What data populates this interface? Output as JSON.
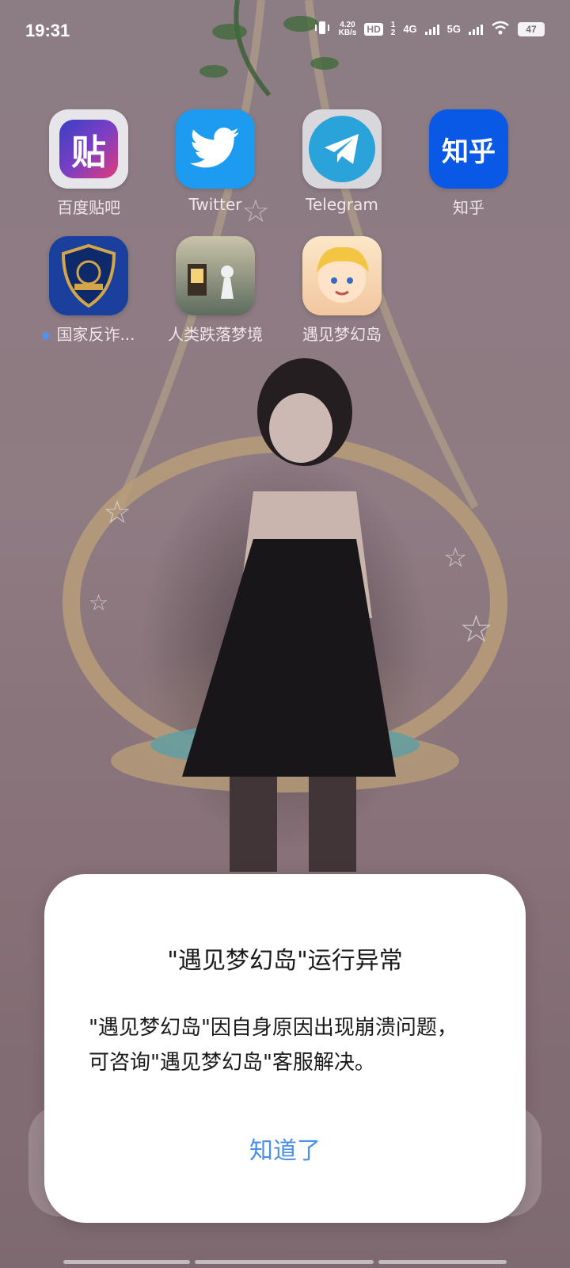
{
  "status_bar": {
    "time": "19:31",
    "speed_value": "4.20",
    "speed_unit": "KB/s",
    "hd_label": "HD",
    "sim_index_top": "1",
    "sim_index_bottom": "2",
    "network_1": "4G",
    "network_2": "5G",
    "battery": "47"
  },
  "apps": [
    {
      "label": "百度贴吧",
      "glyph": "贴",
      "icon": "baidu-tieba-icon",
      "color": "#3a3fc4"
    },
    {
      "label": "Twitter",
      "glyph": "🐦",
      "icon": "twitter-bird-icon",
      "color": "#1d9bf0"
    },
    {
      "label": "Telegram",
      "glyph": "➤",
      "icon": "telegram-plane-icon",
      "color": "#2aa3db"
    },
    {
      "label": "知乎",
      "glyph": "知乎",
      "icon": "zhihu-icon",
      "color": "#0a58e6"
    },
    {
      "label": "国家反诈...",
      "icon": "anti-fraud-shield-icon",
      "color": "#1a3f9c",
      "new_indicator": true
    },
    {
      "label": "人类跌落梦境",
      "icon": "human-fall-flat-icon",
      "color": "#5d6b5e"
    },
    {
      "label": "遇见梦幻岛",
      "icon": "dream-island-game-icon",
      "color": "#f2c7a0"
    }
  ],
  "dialog": {
    "title": "\"遇见梦幻岛\"运行异常",
    "message_line1": "\"遇见梦幻岛\"因自身原因出现崩溃问题，",
    "message_line2": "可咨询\"遇见梦幻岛\"客服解决。",
    "button_label": "知道了"
  }
}
